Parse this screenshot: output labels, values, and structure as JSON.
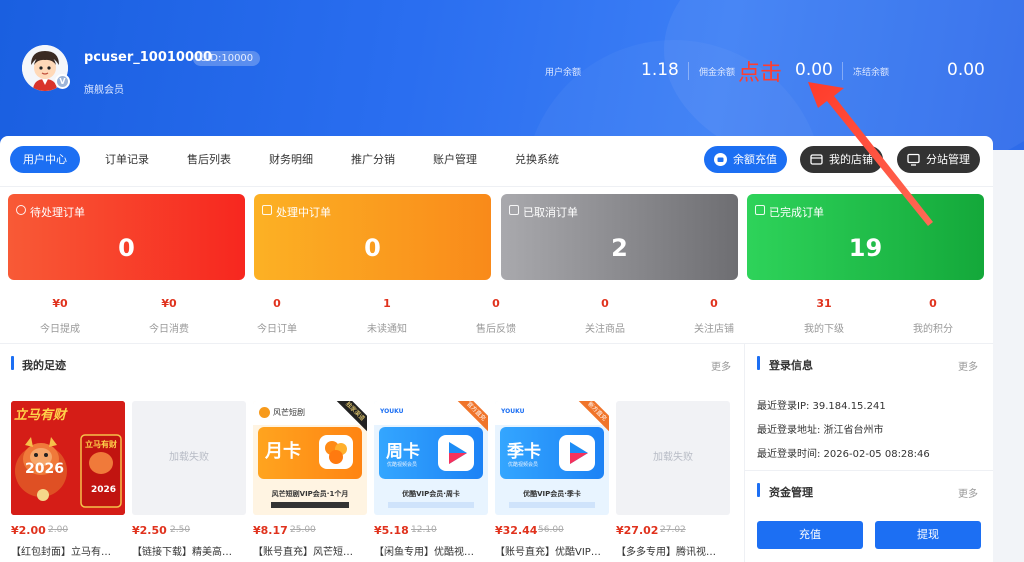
{
  "profile": {
    "username": "pcuser_10010000",
    "uid": "UID:10000",
    "member_level": "旗舰会员"
  },
  "balances": [
    {
      "label": "用户余额",
      "value": "1.18"
    },
    {
      "label": "佣金余额",
      "value": "0.00"
    },
    {
      "label": "冻结余额",
      "value": "0.00"
    }
  ],
  "annotation": {
    "text": "点击",
    "color": "#ff3d2e"
  },
  "tabs": [
    "用户中心",
    "订单记录",
    "售后列表",
    "财务明细",
    "推广分销",
    "账户管理",
    "兑换系统"
  ],
  "actions": {
    "recharge": "余额充值",
    "my_shop": "我的店铺",
    "substation": "分站管理"
  },
  "order_stats": [
    {
      "label": "待处理订单",
      "value": "0",
      "icon": "clock-icon"
    },
    {
      "label": "处理中订单",
      "value": "0",
      "icon": "doc-icon"
    },
    {
      "label": "已取消订单",
      "value": "2",
      "icon": "doc-cancel-icon"
    },
    {
      "label": "已完成订单",
      "value": "19",
      "icon": "doc-done-icon"
    }
  ],
  "mini_stats": [
    {
      "value": "¥0",
      "label": "今日提成"
    },
    {
      "value": "¥0",
      "label": "今日消费"
    },
    {
      "value": "0",
      "label": "今日订单"
    },
    {
      "value": "1",
      "label": "未读通知"
    },
    {
      "value": "0",
      "label": "售后反馈"
    },
    {
      "value": "0",
      "label": "关注商品"
    },
    {
      "value": "0",
      "label": "关注店铺"
    },
    {
      "value": "31",
      "label": "我的下级"
    },
    {
      "value": "0",
      "label": "我的积分"
    }
  ],
  "footprint": {
    "title": "我的足迹",
    "more": "更多",
    "failed_text": "加载失败",
    "products": [
      {
        "price": "¥2.00",
        "orig": "2.00",
        "title": "【红包封面】立马有…",
        "image": "red-envelope"
      },
      {
        "price": "¥2.50",
        "orig": "2.50",
        "title": "【链接下载】精美高…",
        "image": "failed"
      },
      {
        "price": "¥8.17",
        "orig": "25.00",
        "title": "【账号直充】风芒短…",
        "image": "monthly-card"
      },
      {
        "price": "¥5.18",
        "orig": "12.10",
        "title": "【闲鱼专用】优酷视…",
        "image": "weekly-card"
      },
      {
        "price": "¥32.44",
        "orig": "56.00",
        "title": "【账号直充】优酷VIP…",
        "image": "season-card"
      },
      {
        "price": "¥27.02",
        "orig": "27.02",
        "title": "【多多专用】腾讯视…",
        "image": "failed"
      }
    ],
    "card_texts": {
      "tag_exclusive": "独家渠道",
      "tag_official": "官方直充",
      "tag_new": "新方直充",
      "fm_brand": "风芒短剧",
      "fm_card": "月卡",
      "fm_desc": "风芒短剧VIP会员·1个月",
      "youku": "YOUKU",
      "week_card": "周卡",
      "season_card": "季卡",
      "youku_member": "优酷视频会员",
      "youku_week": "优酷VIP会员·周卡",
      "youku_season": "优酷VIP会员·季卡",
      "cny_top": "立马有财",
      "cny_year": "2026"
    }
  },
  "login_info": {
    "title": "登录信息",
    "more": "更多",
    "ip": "最近登录IP: 39.184.15.241",
    "location": "最近登录地址: 浙江省台州市",
    "time": "最近登录时间: 2026-02-05 08:28:46"
  },
  "funds": {
    "title": "资金管理",
    "more": "更多",
    "recharge": "充值",
    "withdraw": "提现"
  },
  "colors": {
    "primary": "#1c6ff3",
    "price": "#e0321d",
    "pending": "#f7342a",
    "processing": "#fb9a1c",
    "cancelled": "#8a8a8e",
    "done": "#1fc04a"
  }
}
